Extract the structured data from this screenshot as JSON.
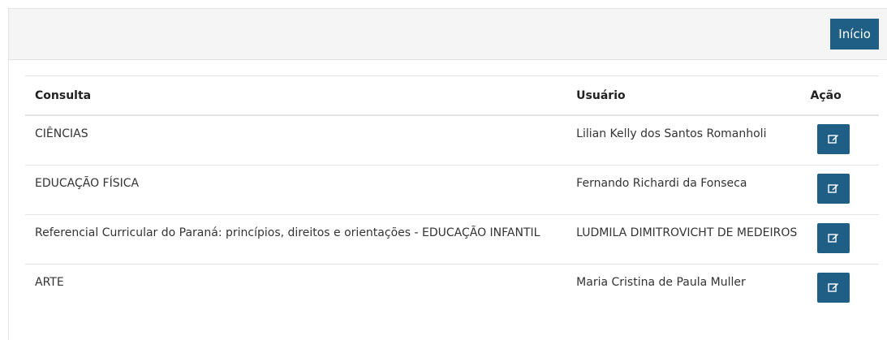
{
  "header": {
    "inicio_label": "Início"
  },
  "table": {
    "columns": [
      "Consulta",
      "Usuário",
      "Ação"
    ],
    "rows": [
      {
        "consulta": "CIÊNCIAS",
        "usuario": "Lilian Kelly dos Santos Romanholi"
      },
      {
        "consulta": "EDUCAÇÃO FÍSICA",
        "usuario": "Fernando Richardi da Fonseca"
      },
      {
        "consulta": "Referencial Curricular do Paraná: princípios, direitos e orientações - EDUCAÇÃO INFANTIL",
        "usuario": "LUDMILA DIMITROVICHT DE MEDEIROS"
      },
      {
        "consulta": "ARTE",
        "usuario": "Maria Cristina de Paula Muller"
      }
    ],
    "action_icon": "edit-icon"
  },
  "colors": {
    "primary": "#1f5f86",
    "header_bg": "#f5f5f5",
    "border": "#e3e3e3"
  }
}
